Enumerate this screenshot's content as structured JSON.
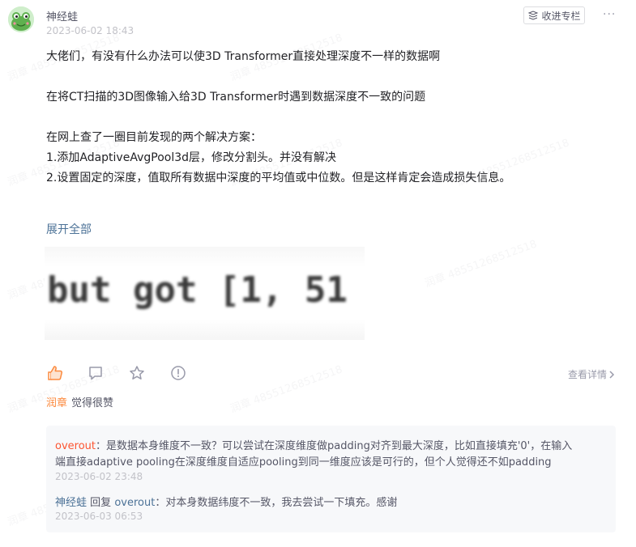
{
  "meta": {
    "author": "神经蛙",
    "time": "2023-06-02 18:43",
    "collect_label": "收进专栏",
    "more_label": "···"
  },
  "post": {
    "line1": "大佬们，有没有什么办法可以使3D Transformer直接处理深度不一样的数据啊",
    "line2": "在将CT扫描的3D图像输入给3D Transformer时遇到数据深度不一致的问题",
    "line3": "在网上查了一圈目前发现的两个解决方案：",
    "line4": "1.添加AdaptiveAvgPool3d层，修改分割头。并没有解决",
    "line5": "2.设置固定的深度，值取所有数据中深度的平均值或中位数。但是这样肯定会造成损失信息。",
    "expand_label": "展开全部",
    "snippet_text": "but got [1, 51"
  },
  "actions": {
    "view_detail_label": "查看详情",
    "like_icon": "thumbs-up-icon",
    "comment_icon": "comment-icon",
    "star_icon": "star-icon",
    "report_icon": "alert-icon",
    "accent_color": "#fc8a3e"
  },
  "liker": {
    "name": "润章",
    "text": "觉得很赞"
  },
  "comments": [
    {
      "user": "overout",
      "text_line1": "：是数据本身维度不一致？可以尝试在深度维度做padding对齐到最大深度，比如直接填充'0'，在输入",
      "text_line2": "端直接adaptive pooling在深度维度自适应pooling到同一维度应该是可行的，但个人觉得还不如padding",
      "time": "2023-06-02 23:48"
    },
    {
      "user": "神经蛙",
      "reply_word": "回复",
      "reply_to": "overout",
      "text": "：对本身数据纬度不一致，我去尝试一下填充。感谢",
      "time": "2023-06-03 06:53"
    }
  ],
  "watermark_text": "润章 4855126851251b"
}
